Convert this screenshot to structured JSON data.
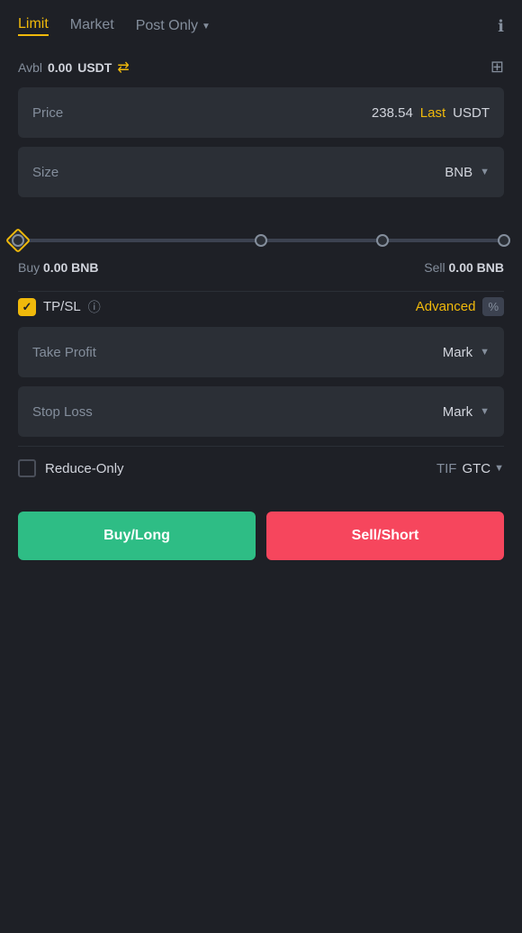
{
  "tabs": {
    "limit_label": "Limit",
    "market_label": "Market",
    "post_only_label": "Post Only",
    "info_icon": "ℹ"
  },
  "avbl": {
    "label": "Avbl",
    "value": "0.00",
    "currency": "USDT",
    "transfer_icon": "⇄",
    "wallet_icon": "▦"
  },
  "price_field": {
    "label": "Price",
    "value": "238.54",
    "highlight": "Last",
    "currency": "USDT"
  },
  "size_field": {
    "label": "Size",
    "currency": "BNB"
  },
  "slider": {
    "percent": 0
  },
  "buy_sell": {
    "buy_label": "Buy",
    "buy_value": "0.00",
    "buy_currency": "BNB",
    "sell_label": "Sell",
    "sell_value": "0.00",
    "sell_currency": "BNB"
  },
  "tpsl": {
    "label": "TP/SL",
    "advanced_label": "Advanced",
    "percent_symbol": "%"
  },
  "take_profit": {
    "label": "Take Profit",
    "mark_label": "Mark"
  },
  "stop_loss": {
    "label": "Stop Loss",
    "mark_label": "Mark"
  },
  "reduce_only": {
    "label": "Reduce-Only",
    "tif_label": "TIF",
    "gtc_value": "GTC"
  },
  "buttons": {
    "buy_label": "Buy/Long",
    "sell_label": "Sell/Short"
  }
}
